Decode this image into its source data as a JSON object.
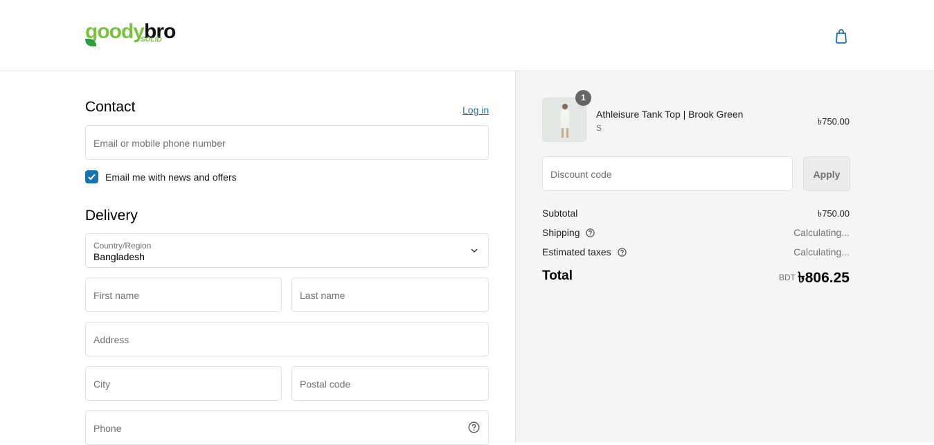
{
  "brand": {
    "name_part1": "goody",
    "name_part2": "bro",
    "tagline": "SOLID"
  },
  "contact": {
    "heading": "Contact",
    "login_link": "Log in",
    "email_placeholder": "Email or mobile phone number",
    "newsletter_label": "Email me with news and offers",
    "newsletter_checked": true
  },
  "delivery": {
    "heading": "Delivery",
    "country_label": "Country/Region",
    "country_value": "Bangladesh",
    "first_name_placeholder": "First name",
    "last_name_placeholder": "Last name",
    "address_placeholder": "Address",
    "city_placeholder": "City",
    "postal_placeholder": "Postal code",
    "phone_placeholder": "Phone"
  },
  "summary": {
    "item": {
      "quantity": "1",
      "name": "Athleisure Tank Top | Brook Green",
      "variant": "S",
      "price": "৳750.00"
    },
    "discount_placeholder": "Discount code",
    "apply_label": "Apply",
    "subtotal_label": "Subtotal",
    "subtotal_value": "৳750.00",
    "shipping_label": "Shipping",
    "shipping_value": "Calculating...",
    "taxes_label": "Estimated taxes",
    "taxes_value": "Calculating...",
    "total_label": "Total",
    "currency": "BDT",
    "total_value": "৳806.25"
  },
  "colors": {
    "accent": "#1773b0",
    "brand_green": "#7ac142",
    "sidebar_bg": "#f5f5f5"
  },
  "icons": [
    "shopping-bag-icon",
    "checkmark-icon",
    "chevron-down-icon",
    "help-circle-icon"
  ]
}
